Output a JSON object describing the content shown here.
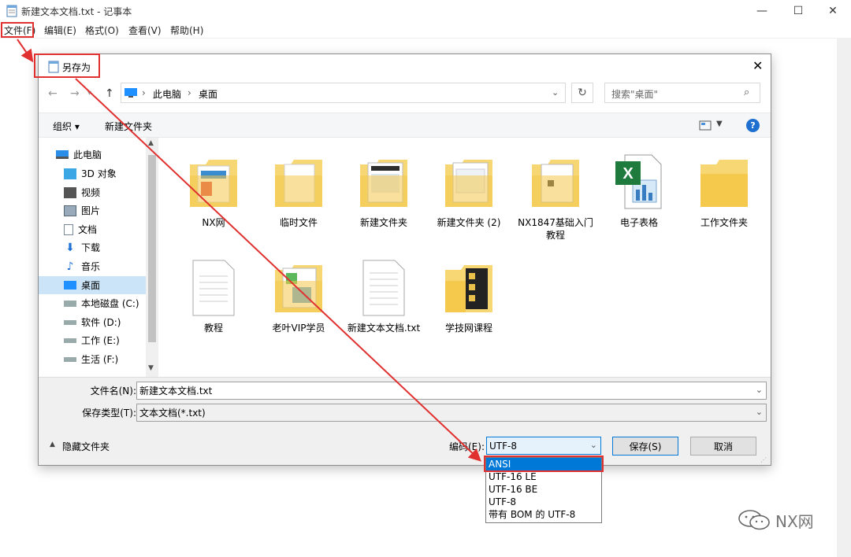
{
  "window": {
    "title": "新建文本文档.txt - 记事本",
    "min": "—",
    "max": "☐",
    "close": "✕"
  },
  "menu": [
    {
      "label": "文件(F)"
    },
    {
      "label": "编辑(E)"
    },
    {
      "label": "格式(O)"
    },
    {
      "label": "查看(V)"
    },
    {
      "label": "帮助(H)"
    }
  ],
  "dialog": {
    "title": "另存为",
    "close": "✕",
    "path": [
      "此电脑",
      "桌面"
    ],
    "search_placeholder": "搜索\"桌面\"",
    "toolbar": {
      "organize": "组织 ▾",
      "new_folder": "新建文件夹",
      "help": "?"
    },
    "nav": [
      {
        "label": "此电脑",
        "icon": "pc-icon"
      },
      {
        "label": "3D 对象",
        "icon": "3d-icon"
      },
      {
        "label": "视频",
        "icon": "video-icon"
      },
      {
        "label": "图片",
        "icon": "pictures-icon"
      },
      {
        "label": "文档",
        "icon": "documents-icon"
      },
      {
        "label": "下载",
        "icon": "download-icon"
      },
      {
        "label": "音乐",
        "icon": "music-icon"
      },
      {
        "label": "桌面",
        "icon": "desktop-icon"
      },
      {
        "label": "本地磁盘 (C:)",
        "icon": "drive-icon"
      },
      {
        "label": "软件 (D:)",
        "icon": "drive-icon"
      },
      {
        "label": "工作 (E:)",
        "icon": "drive-icon"
      },
      {
        "label": "生活 (F:)",
        "icon": "drive-icon"
      }
    ],
    "files": [
      {
        "label": "NX网",
        "icon": "folder-icon"
      },
      {
        "label": "临时文件",
        "icon": "folder-icon"
      },
      {
        "label": "新建文件夹",
        "icon": "folder-icon"
      },
      {
        "label": "新建文件夹 (2)",
        "icon": "folder-icon"
      },
      {
        "label": "NX1847基础入门教程",
        "icon": "folder-icon"
      },
      {
        "label": "电子表格",
        "icon": "excel-icon"
      },
      {
        "label": "工作文件夹",
        "icon": "folder-icon"
      },
      {
        "label": "教程",
        "icon": "text-file-icon"
      },
      {
        "label": "老叶VIP学员",
        "icon": "folder-icon"
      },
      {
        "label": "新建文本文档.txt",
        "icon": "text-file-icon"
      },
      {
        "label": "学技网课程",
        "icon": "folder-icon"
      }
    ],
    "filename_label": "文件名(N):",
    "filename": "新建文本文档.txt",
    "filetype_label": "保存类型(T):",
    "filetype": "文本文档(*.txt)",
    "hide_folders": "隐藏文件夹",
    "encoding_label": "编码(E):",
    "encoding": "UTF-8",
    "save": "保存(S)",
    "cancel": "取消"
  },
  "encoding_options": [
    "ANSI",
    "UTF-16 LE",
    "UTF-16 BE",
    "UTF-8",
    "带有 BOM 的 UTF-8"
  ],
  "watermark": "NX网",
  "colors": {
    "accent": "#0078d7",
    "highlight": "#e03030",
    "folder": "#f7d774"
  }
}
